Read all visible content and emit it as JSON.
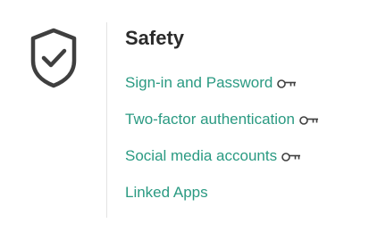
{
  "section": {
    "title": "Safety",
    "icon": "shield-check-icon"
  },
  "links": [
    {
      "label": "Sign-in and Password",
      "icon": "key-icon"
    },
    {
      "label": "Two-factor authentication",
      "icon": "key-icon"
    },
    {
      "label": "Social media accounts",
      "icon": "key-icon"
    },
    {
      "label": "Linked Apps",
      "icon": ""
    }
  ],
  "colors": {
    "link": "#2a9a82",
    "title": "#2b2b2b",
    "icon": "#3f3f3f",
    "divider": "#e3e3e3"
  }
}
